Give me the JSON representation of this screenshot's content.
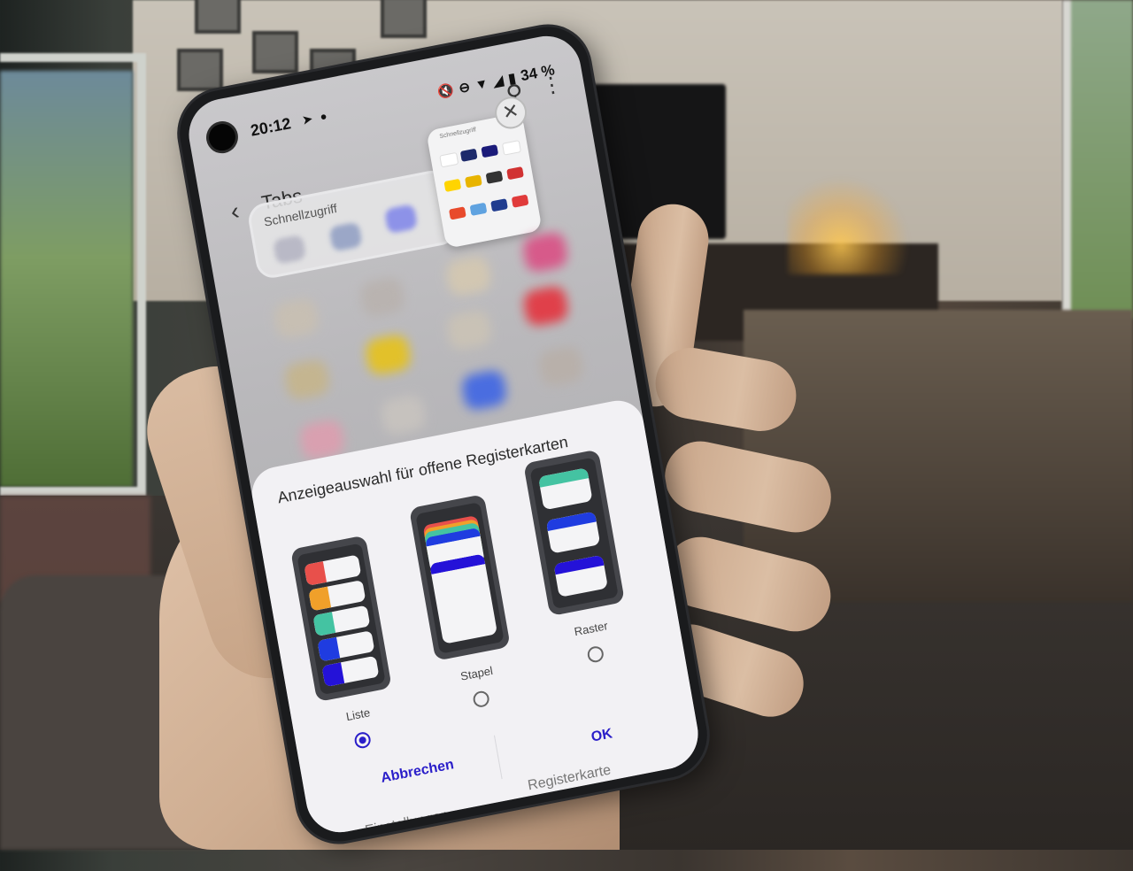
{
  "status_bar": {
    "time": "20:12",
    "battery": "34 %",
    "icons": [
      "telegram-icon",
      "chat-bubble-icon",
      "mute-icon",
      "do-not-disturb-icon",
      "wifi-icon",
      "signal-icon",
      "battery-icon"
    ]
  },
  "app_bar": {
    "title": "Tabs",
    "back_icon": "back-arrow-icon",
    "search_icon": "search-icon",
    "more_icon": "more-vertical-icon"
  },
  "quick_access": {
    "label": "Schnellzugriff",
    "preview_label": "Schnellzugriff"
  },
  "dialog": {
    "title": "Anzeigeauswahl für offene Registerkarten",
    "options": [
      {
        "label": "Liste",
        "selected": true
      },
      {
        "label": "Stapel",
        "selected": false
      },
      {
        "label": "Raster",
        "selected": false
      }
    ],
    "cancel_label": "Abbrechen",
    "ok_label": "OK"
  },
  "behind_dialog": {
    "left_text": "Einstellungen",
    "right_text": "Registerkarte"
  },
  "colors": {
    "accent": "#2a1ec9",
    "tab_red": "#e8504b",
    "tab_orange": "#f0a02a",
    "tab_teal": "#44c3a2",
    "tab_blue": "#1f3ce0",
    "tab_indigo": "#2412d8"
  }
}
